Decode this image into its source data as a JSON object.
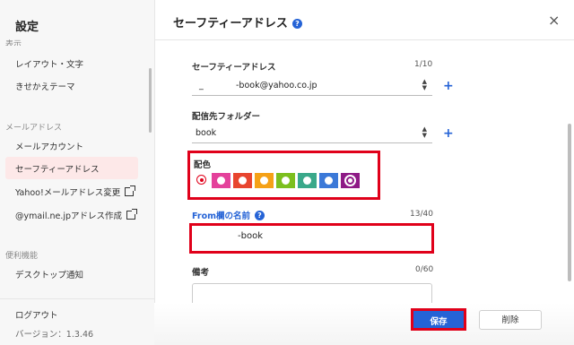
{
  "sidebar": {
    "title": "設定",
    "cut_section": "表示",
    "items": [
      {
        "label": "レイアウト・文字"
      },
      {
        "label": "きせかえテーマ"
      },
      {
        "label": "メールアドレス"
      },
      {
        "label": "メールアカウント"
      },
      {
        "label": "セーフティーアドレス"
      },
      {
        "label": "Yahoo!メールアドレス変更"
      },
      {
        "label": "@ymail.ne.jpアドレス作成"
      },
      {
        "label": "便利機能"
      },
      {
        "label": "デスクトップ通知"
      }
    ],
    "logout": "ログアウト",
    "version": "バージョン：1.3.46"
  },
  "header": {
    "title": "セーフティーアドレス",
    "help": "?",
    "close": "×"
  },
  "form": {
    "address": {
      "label": "セーフティーアドレス",
      "count": "1/10",
      "prefix": "_",
      "value": "-book@yahoo.co.jp"
    },
    "folder": {
      "label": "配信先フォルダー",
      "value": "book"
    },
    "color": {
      "label": "配色",
      "swatches": [
        "#e4419b",
        "#e8452f",
        "#f5a116",
        "#7cbf1e",
        "#3aa88a",
        "#3b79d8",
        "#8e1a86"
      ],
      "selected_index": 6
    },
    "from_name": {
      "label": "From欄の名前",
      "help": "?",
      "count": "13/40",
      "value": "-book"
    },
    "note": {
      "label": "備考",
      "count": "0/60",
      "value": ""
    }
  },
  "buttons": {
    "save": "保存",
    "delete": "削除"
  },
  "icons": {
    "plus": "+",
    "select_arrow_up": "▲",
    "select_arrow_down": "▼"
  },
  "colors": {
    "accent": "#2563d6",
    "highlight": "#e0001a",
    "active_bg": "#fde8e8"
  }
}
